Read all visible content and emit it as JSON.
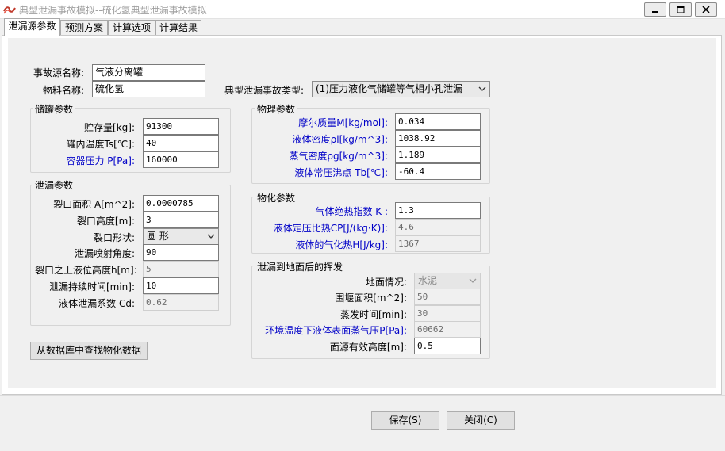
{
  "window": {
    "title": "典型泄漏事故模拟--硫化氢典型泄漏事故模拟",
    "minimize_icon": "minimize-icon",
    "maximize_icon": "maximize-icon",
    "close_icon": "close-icon"
  },
  "tabs": [
    {
      "label": "泄漏源参数",
      "active": true
    },
    {
      "label": "预测方案"
    },
    {
      "label": "计算选项"
    },
    {
      "label": "计算结果"
    }
  ],
  "source": {
    "name_label": "事故源名称:",
    "name_value": "气液分离罐",
    "material_label": "物料名称:",
    "material_value": "硫化氢",
    "accident_type_label": "典型泄漏事故类型:",
    "accident_type_value": "(1)压力液化气储罐等气相小孔泄漏"
  },
  "storage": {
    "title": "储罐参数",
    "fields": [
      {
        "label": "贮存量[kg]:",
        "value": "91300"
      },
      {
        "label": "罐内温度Ts[℃]:",
        "value": "40"
      },
      {
        "label": "容器压力 P[Pa]:",
        "value": "160000"
      }
    ]
  },
  "leak": {
    "title": "泄漏参数",
    "area_label": "裂口面积 A[m^2]:",
    "area_value": "0.0000785",
    "height_label": "裂口高度[m]:",
    "height_value": "3",
    "shape_label": "裂口形状:",
    "shape_value": "圆  形",
    "angle_label": "泄漏喷射角度:",
    "angle_value": "90",
    "liquid_level_label": "裂口之上液位高度h[m]:",
    "liquid_level_value": "5",
    "duration_label": "泄漏持续时间[min]:",
    "duration_value": "10",
    "cd_label": "液体泄漏系数  Cd:",
    "cd_value": "0.62"
  },
  "physical": {
    "title": "物理参数",
    "fields": [
      {
        "label": "摩尔质量M[kg/mol]:",
        "value": "0.034"
      },
      {
        "label": "液体密度ρl[kg/m^3]:",
        "value": "1038.92"
      },
      {
        "label": "蒸气密度ρg[kg/m^3]:",
        "value": "1.189"
      },
      {
        "label": "液体常压沸点 Tb[℃]:",
        "value": "-60.4"
      }
    ]
  },
  "chemical": {
    "title": "物化参数",
    "fields": [
      {
        "label": "气体绝热指数  K :",
        "value": "1.3"
      },
      {
        "label": "液体定压比热CP[J/(kg·K)]:",
        "value": "4.6"
      },
      {
        "label": "液体的气化热H[J/kg]:",
        "value": "1367"
      }
    ]
  },
  "evaporation": {
    "title": "泄漏到地面后的挥发",
    "ground_label": "地面情况:",
    "ground_value": "水泥",
    "dike_label": "围堰面积[m^2]:",
    "dike_value": "50",
    "time_label": "蒸发时间[min]:",
    "time_value": "30",
    "vapor_label": "环境温度下液体表面蒸气压P[Pa]:",
    "vapor_value": "60662",
    "height_label": "面源有效高度[m]:",
    "height_value": "0.5"
  },
  "buttons": {
    "lookup": "从数据库中查找物化数据",
    "save": "保存(S)",
    "close": "关闭(C)"
  },
  "colors": {
    "highlight_label": "#0000c8",
    "readonly_bg": "#f0f0f0",
    "panel_bg": "#ffffff"
  }
}
